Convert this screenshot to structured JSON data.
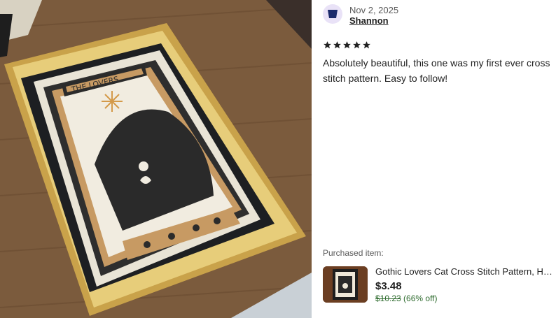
{
  "review": {
    "date": "Nov 2, 2025",
    "reviewer": "Shannon",
    "rating": 5,
    "text": "Absolutely beautiful, this one was my first ever cross stitch pattern. Easy to follow!"
  },
  "photo": {
    "embroidered_title": "THE LOVERS"
  },
  "purchased": {
    "label": "Purchased item:",
    "title": "Gothic Lovers Cat Cross Stitch Pattern, Hallow...",
    "price": "$3.48",
    "original_price": "$10.23",
    "discount": "(66% off)"
  },
  "colors": {
    "avatar_bg": "#e9e2f7",
    "avatar_icon": "#1b2a6b",
    "star": "#222222",
    "discount_green": "#2e6b2e"
  }
}
